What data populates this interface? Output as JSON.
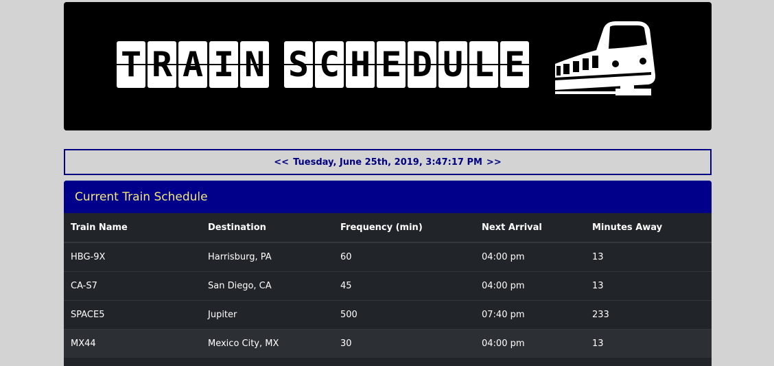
{
  "banner": {
    "title_words": [
      "TRAIN",
      "SCHEDULE"
    ]
  },
  "clock": {
    "prev": "<<",
    "text": "Tuesday, June 25th, 2019, 3:47:17 PM",
    "next": ">>"
  },
  "schedule": {
    "title": "Current Train Schedule",
    "columns": [
      "Train Name",
      "Destination",
      "Frequency (min)",
      "Next Arrival",
      "Minutes Away"
    ],
    "rows": [
      [
        "HBG-9X",
        "Harrisburg, PA",
        "60",
        "04:00 pm",
        "13"
      ],
      [
        "CA-S7",
        "San Diego, CA",
        "45",
        "04:00 pm",
        "13"
      ],
      [
        "SPACE5",
        "Jupiter",
        "500",
        "07:40 pm",
        "233"
      ],
      [
        "MX44",
        "Mexico City, MX",
        "30",
        "04:00 pm",
        "13"
      ]
    ]
  },
  "colors": {
    "page_bg": "#d3d3d3",
    "header_bg": "#00008b",
    "header_text": "#f4e97a",
    "clock_text": "#000080",
    "table_bg": "#212529"
  },
  "icons": {
    "train": "train-icon"
  }
}
